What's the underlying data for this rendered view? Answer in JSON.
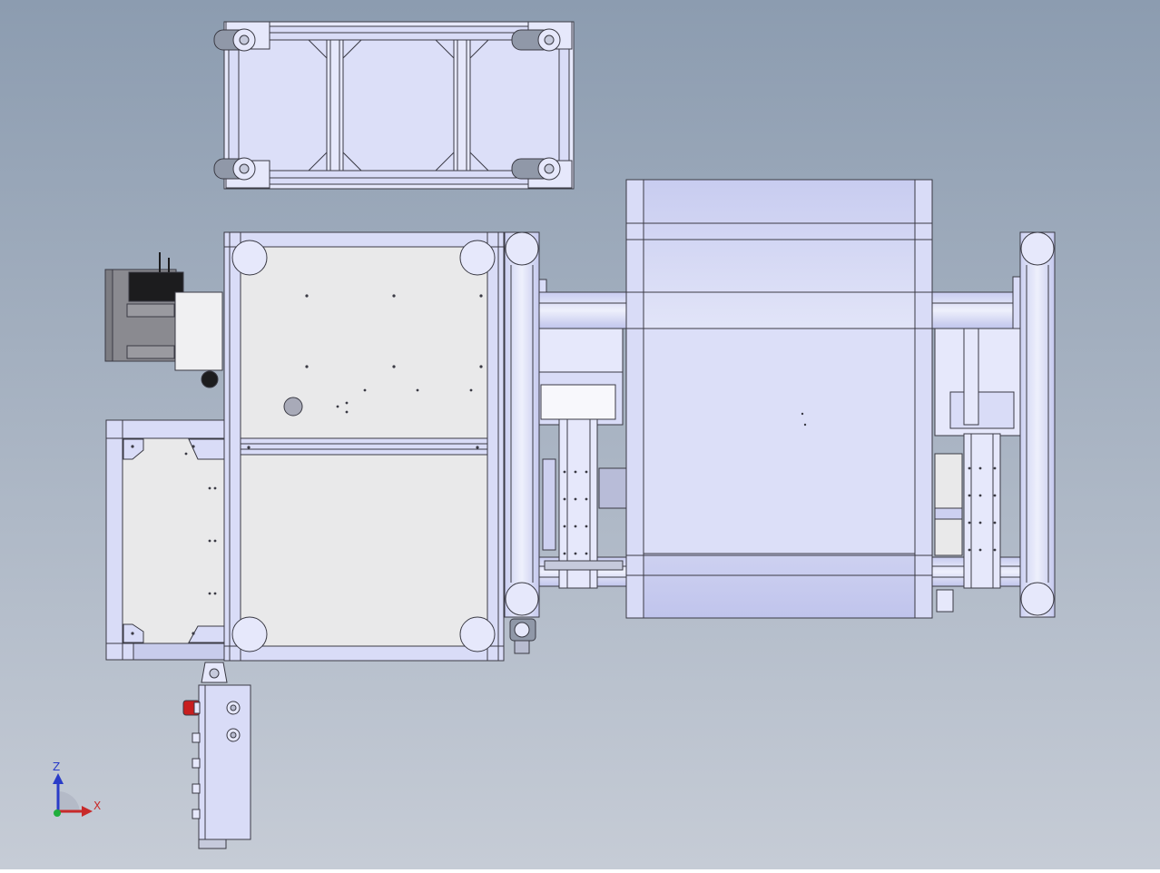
{
  "viewport": {
    "background_top": "#8c9cb0",
    "background_bottom": "#c6ccd6"
  },
  "colors": {
    "frame_fill": "#d9dcf7",
    "frame_light": "#e6e8fb",
    "plate_fill": "#e9e9ea",
    "line": "#3a3a44",
    "motor_body": "#7c7c82",
    "motor_dark": "#1c1c1e",
    "estop_red": "#c81e1e",
    "caster_grey": "#9098a8"
  },
  "triad": {
    "z_label": "Z",
    "x_label": "X",
    "z_color": "#2a3cc8",
    "x_color": "#c82a2a",
    "y_color": "#1fae3c"
  }
}
